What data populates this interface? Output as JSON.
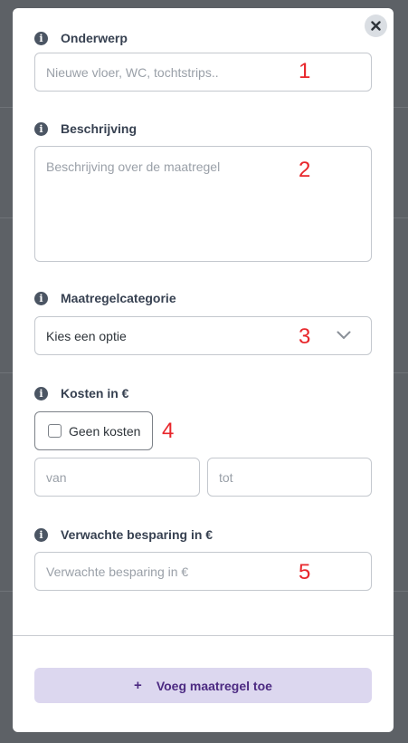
{
  "form": {
    "subject": {
      "label": "Onderwerp",
      "placeholder": "Nieuwe vloer, WC, tochtstrips..",
      "annotation": "1"
    },
    "description": {
      "label": "Beschrijving",
      "placeholder": "Beschrijving over de maatregel",
      "annotation": "2"
    },
    "category": {
      "label": "Maatregelcategorie",
      "selected": "Kies een optie",
      "annotation": "3"
    },
    "costs": {
      "label": "Kosten in €",
      "no_costs_label": "Geen kosten",
      "annotation": "4",
      "from_placeholder": "van",
      "to_placeholder": "tot"
    },
    "savings": {
      "label": "Verwachte besparing in €",
      "placeholder": "Verwachte besparing in €",
      "annotation": "5"
    },
    "submit": {
      "plus": "+",
      "label": "Voeg maatregel toe"
    }
  },
  "icons": {
    "info": "info-icon",
    "close": "close-icon",
    "chevron": "chevron-down-icon"
  },
  "colors": {
    "accent_bg": "#dcd7ef",
    "accent_text": "#4c2a82",
    "annotation": "#e8262b"
  }
}
